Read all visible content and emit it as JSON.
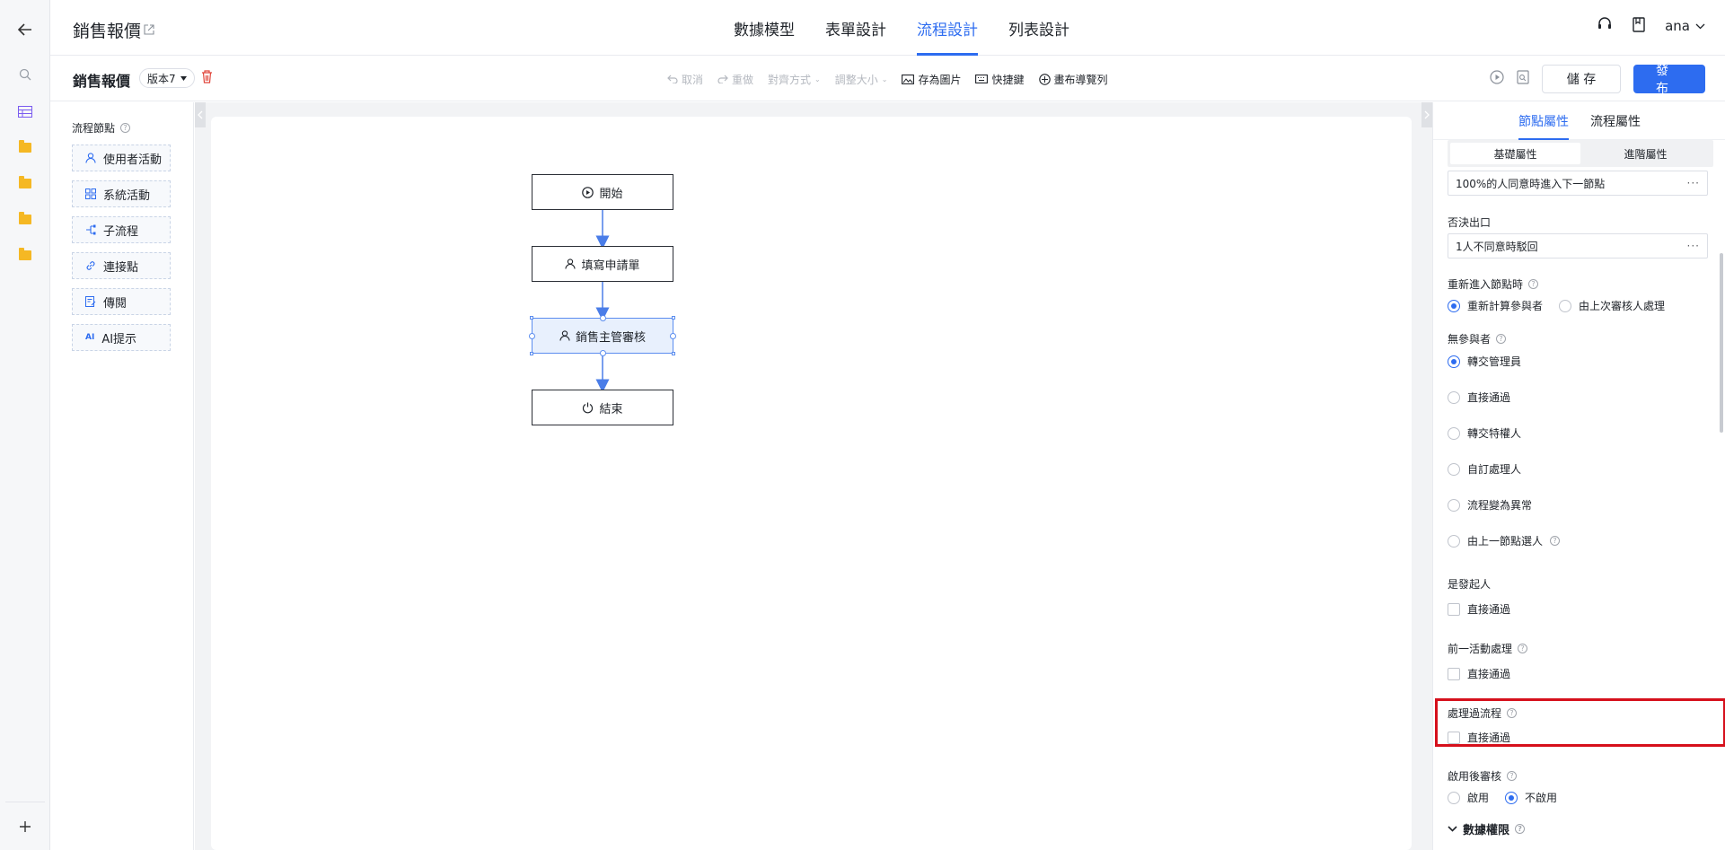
{
  "header": {
    "app_title": "銷售報價",
    "tabs": [
      "數據模型",
      "表單設計",
      "流程設計",
      "列表設計"
    ],
    "active_tab": "流程設計",
    "user": "ana"
  },
  "toolbar": {
    "title": "銷售報價",
    "version": "版本7",
    "undo": "取消",
    "redo": "重做",
    "align": "對齊方式",
    "resize": "調整大小",
    "save_image": "存為圖片",
    "shortcuts": "快捷鍵",
    "nav": "畫布導覽列",
    "save": "儲 存",
    "publish": "發 布"
  },
  "palette": {
    "title": "流程節點",
    "items": [
      "使用者活動",
      "系統活動",
      "子流程",
      "連接點",
      "傳閱",
      "AI提示"
    ]
  },
  "flow": {
    "nodes": [
      "開始",
      "填寫申請單",
      "銷售主管審核",
      "結束"
    ]
  },
  "props": {
    "tabs": [
      "節點屬性",
      "流程屬性"
    ],
    "subtabs": [
      "基礎屬性",
      "進階屬性"
    ],
    "approve_exit_value": "100%的人同意時進入下一節點",
    "reject_exit_label": "否決出口",
    "reject_exit_value": "1人不同意時駁回",
    "reenter_label": "重新進入節點時",
    "reenter_options": [
      "重新計算參與者",
      "由上次審核人處理"
    ],
    "no_participant_label": "無參與者",
    "no_participant_options": [
      "轉交管理員",
      "直接通過",
      "轉交特權人",
      "自訂處理人",
      "流程變為異常",
      "由上一節點選人"
    ],
    "initiator_label": "是發起人",
    "initiator_check": "直接通過",
    "prev_label": "前一活動處理",
    "prev_check": "直接通過",
    "processed_label": "處理過流程",
    "processed_check": "直接通過",
    "post_review_label": "啟用後審核",
    "post_review_options": [
      "啟用",
      "不啟用"
    ],
    "data_perm_label": "數據權限"
  },
  "colors": {
    "accent": "#2d6cf0",
    "highlight": "#d6101c"
  }
}
